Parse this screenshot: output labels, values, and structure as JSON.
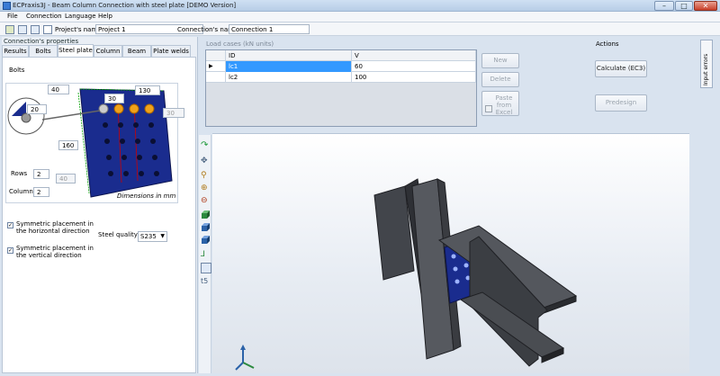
{
  "window": {
    "title": "ECPraxis3J - Beam Column Connection with steel plate [DEMO Version]",
    "buttons": [
      "–",
      "□",
      "✕"
    ]
  },
  "menu": [
    "File",
    "Connection",
    "Language",
    "Help"
  ],
  "toolbar": {
    "project_label": "Project's name:",
    "project_value": "Project 1",
    "connection_label": "Connection's name:",
    "connection_value": "Connection 1"
  },
  "left": {
    "section_title": "Connection's properties",
    "tabs": [
      "Results",
      "Bolts",
      "Steel plate",
      "Column",
      "Beam",
      "Plate welds"
    ],
    "active_tab": "Steel plate",
    "group_title": "Bolts",
    "diagram": {
      "dims": [
        "40",
        "130",
        "30",
        "20",
        "160",
        "40",
        "30"
      ],
      "caption": "Dimensions in mm"
    },
    "rows_label": "Rows",
    "rows_value": "2",
    "columns_label": "Columns",
    "columns_value": "2",
    "sym_h": "Symmetric placement in the horizontal direction",
    "sym_v": "Symmetric placement in the vertical direction",
    "steel_quality_label": "Steel quality",
    "steel_quality_value": "S235"
  },
  "load_cases": {
    "title": "Load cases (kN units)",
    "columns": [
      "ID",
      "V"
    ],
    "rows": [
      {
        "id": "lc1",
        "v": "60"
      },
      {
        "id": "lc2",
        "v": "100"
      }
    ]
  },
  "grid_buttons": {
    "new": "New",
    "delete": "Delete",
    "paste": "Paste from Excel"
  },
  "actions": {
    "title": "Actions",
    "calculate": "Calculate (EC3)",
    "predesign": "Predesign"
  },
  "side_tab": "Input errors",
  "viewport_tools": [
    "rotate-icon",
    "pan-icon",
    "zoom-icon",
    "zoom-in-icon",
    "zoom-out-icon",
    "cube-front-icon",
    "cube-side-icon",
    "cube-top-icon",
    "axes-icon",
    "fit-icon",
    "text-icon"
  ],
  "colors": {
    "steel": "#3c3f45",
    "plate": "#1a2c8e",
    "selection": "#3399ff"
  }
}
